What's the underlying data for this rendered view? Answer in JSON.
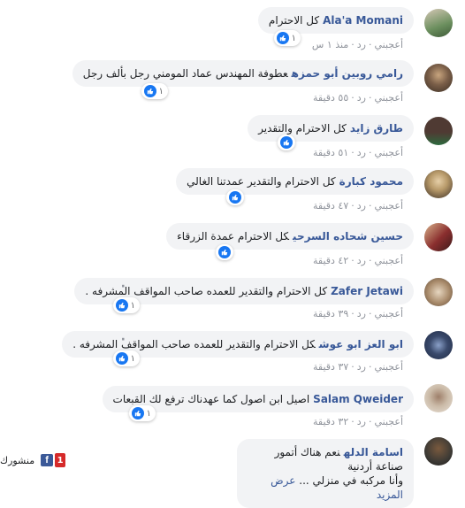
{
  "meta": {
    "like_label": "أعجبني",
    "reply_label": "رد",
    "dot": "·"
  },
  "comments": [
    {
      "name": "Ala'a Momani",
      "text": "كل الاحترام",
      "time": "منذ ١ س",
      "reactions": "١",
      "avatar_colors": [
        "#6b8f5e",
        "#d4c7b5"
      ]
    },
    {
      "name": "رامي روبين أبو حمزه",
      "text": "عطوفة المهندس عماد المومني رجل بألف رجل",
      "time": "٥٥ دقيقة",
      "reactions": "١",
      "avatar_colors": [
        "#5a4a3a",
        "#c8a57e"
      ]
    },
    {
      "name": "طارق زايد",
      "text": "كل الاحترام والتقدير",
      "time": "٥١ دقيقة",
      "reactions": "",
      "avatar_colors": [
        "#4f3a33",
        "#2d6a3e"
      ]
    },
    {
      "name": "محمود كبارة",
      "text": "كل الاحترام والتقدير عمدتنا الغالي",
      "time": "٤٧ دقيقة",
      "reactions": "",
      "avatar_colors": [
        "#b89a6a",
        "#3b2f25"
      ]
    },
    {
      "name": "حسين شحاده السرحي",
      "text": "كل الاحترام عمدة الزرقاء",
      "time": "٤٢ دقيقة",
      "reactions": "",
      "avatar_colors": [
        "#8a2e2e",
        "#d9b38c"
      ]
    },
    {
      "name": "Zafer Jetawi",
      "text": "كل الاحترام والتقدير للعمده صاحب المواقف المشرفه .",
      "time": "٣٩ دقيقة",
      "reactions": "١",
      "avatar_colors": [
        "#a88a6a",
        "#e6d6c0"
      ]
    },
    {
      "name": "ابو العز ابو عوش",
      "text": "كل الاحترام والتقدير للعمده صاحب المواقف المشرفه .",
      "time": "٣٧ دقيقة",
      "reactions": "١",
      "avatar_colors": [
        "#1f2a44",
        "#8aa0c8"
      ]
    },
    {
      "name": "Salam Qweider",
      "text": "اصيل ابن اصول كما عهدناك ترفع لك القبعات",
      "time": "٣٢ دقيقة",
      "reactions": "١",
      "avatar_colors": [
        "#d8cfc4",
        "#9e7f6a"
      ]
    },
    {
      "name": "اسامة الدله",
      "text": "نعم هناك أتمور صناعة أردنية",
      "text2": "وأنا مركبه في منزلي ...",
      "see_more": "عرض المزيد",
      "avatar_colors": [
        "#3d3a35",
        "#7a5a3e"
      ]
    }
  ],
  "share_bar": {
    "count": "1",
    "fb_letter": "f",
    "label": "منشورك"
  },
  "colors": {
    "name": "#385898",
    "like_blue": "#1877f2",
    "bubble_bg": "#f2f3f5",
    "meta": "#90949c"
  }
}
